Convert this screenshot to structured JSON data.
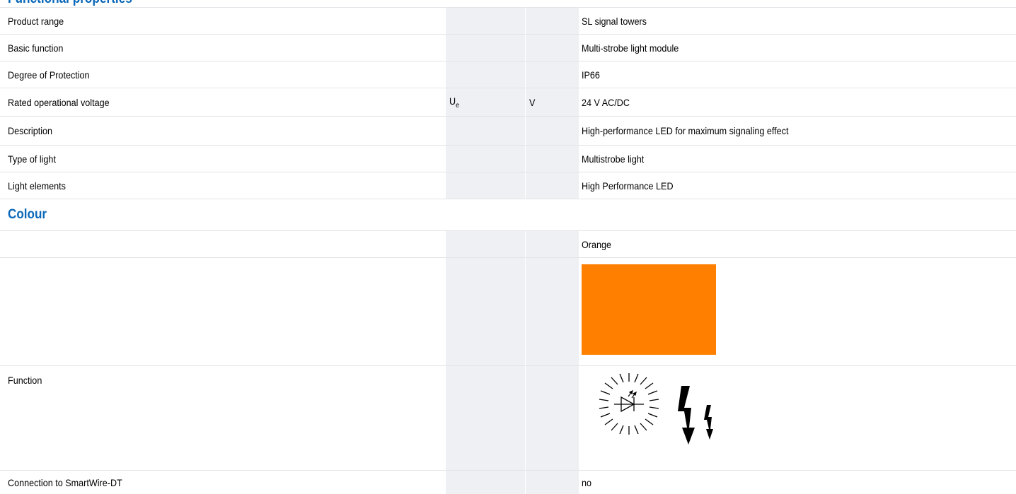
{
  "header": {
    "title": "Functional properties"
  },
  "rows": [
    {
      "label": "Product range",
      "symbol": "",
      "unit": "",
      "value": "SL signal towers"
    },
    {
      "label": "Basic function",
      "symbol": "",
      "unit": "",
      "value": "Multi-strobe light module"
    },
    {
      "label": "Degree of Protection",
      "symbol": "",
      "unit": "",
      "value": "IP66"
    },
    {
      "label": "Rated operational voltage",
      "symbol": "U",
      "symbol_sub": "e",
      "unit": "V",
      "value": "24 V AC/DC"
    },
    {
      "label": "Description",
      "symbol": "",
      "unit": "",
      "value": "High-performance LED for maximum signaling effect"
    },
    {
      "label": "Type of light",
      "symbol": "",
      "unit": "",
      "value": "Multistrobe light"
    },
    {
      "label": "Light elements",
      "symbol": "",
      "unit": "",
      "value": "High Performance LED"
    }
  ],
  "colour_section": {
    "title": "Colour",
    "value": "Orange",
    "swatch_color": "#ff7f00"
  },
  "function_row": {
    "label": "Function",
    "icon": "multistrobe-led-flash-icon"
  },
  "smartwire_row": {
    "label": "Connection to SmartWire-DT",
    "value": "no"
  },
  "colors": {
    "accent": "#0b68b8",
    "shade": "#eef0f4",
    "border": "#e3e4e7"
  }
}
